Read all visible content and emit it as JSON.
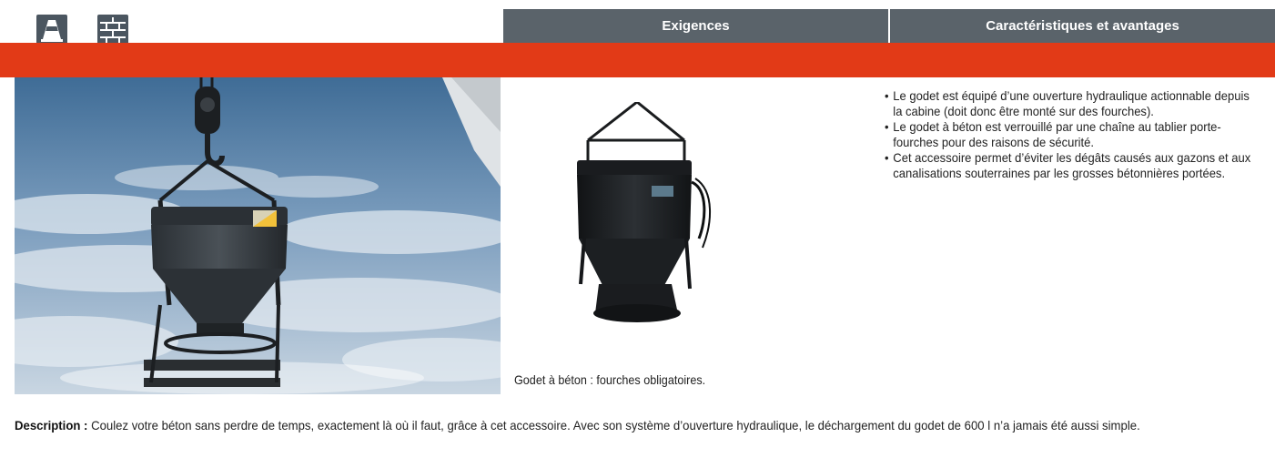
{
  "header": {
    "icons": [
      "construction-cone-icon",
      "brick-wall-icon"
    ],
    "tabs": [
      {
        "label": "Exigences"
      },
      {
        "label": "Caractéristiques et avantages"
      }
    ],
    "colors": {
      "tab_bg": "#5a636a",
      "band": "#e23a17",
      "icon_bg": "#4b5660"
    }
  },
  "main": {
    "caption": "Godet à béton : fourches obligatoires.",
    "bullets": [
      "Le godet est équipé d’une ouverture hydraulique actionnable depuis la cabine (doit donc être monté sur des fourches).",
      "Le godet à béton est verrouillé par une chaîne au tablier porte-fourches pour des raisons de sécurité.",
      "Cet accessoire permet d’éviter les dégâts causés aux gazons et aux canalisations souterraines par les grosses bétonnières portées."
    ]
  },
  "description": {
    "label": "Description :",
    "text": " Coulez votre béton sans perdre de temps, exactement là où il faut, grâce à cet accessoire. Avec son système d’ouverture hydraulique, le déchargement du godet de 600 l n’a jamais été aussi simple."
  }
}
